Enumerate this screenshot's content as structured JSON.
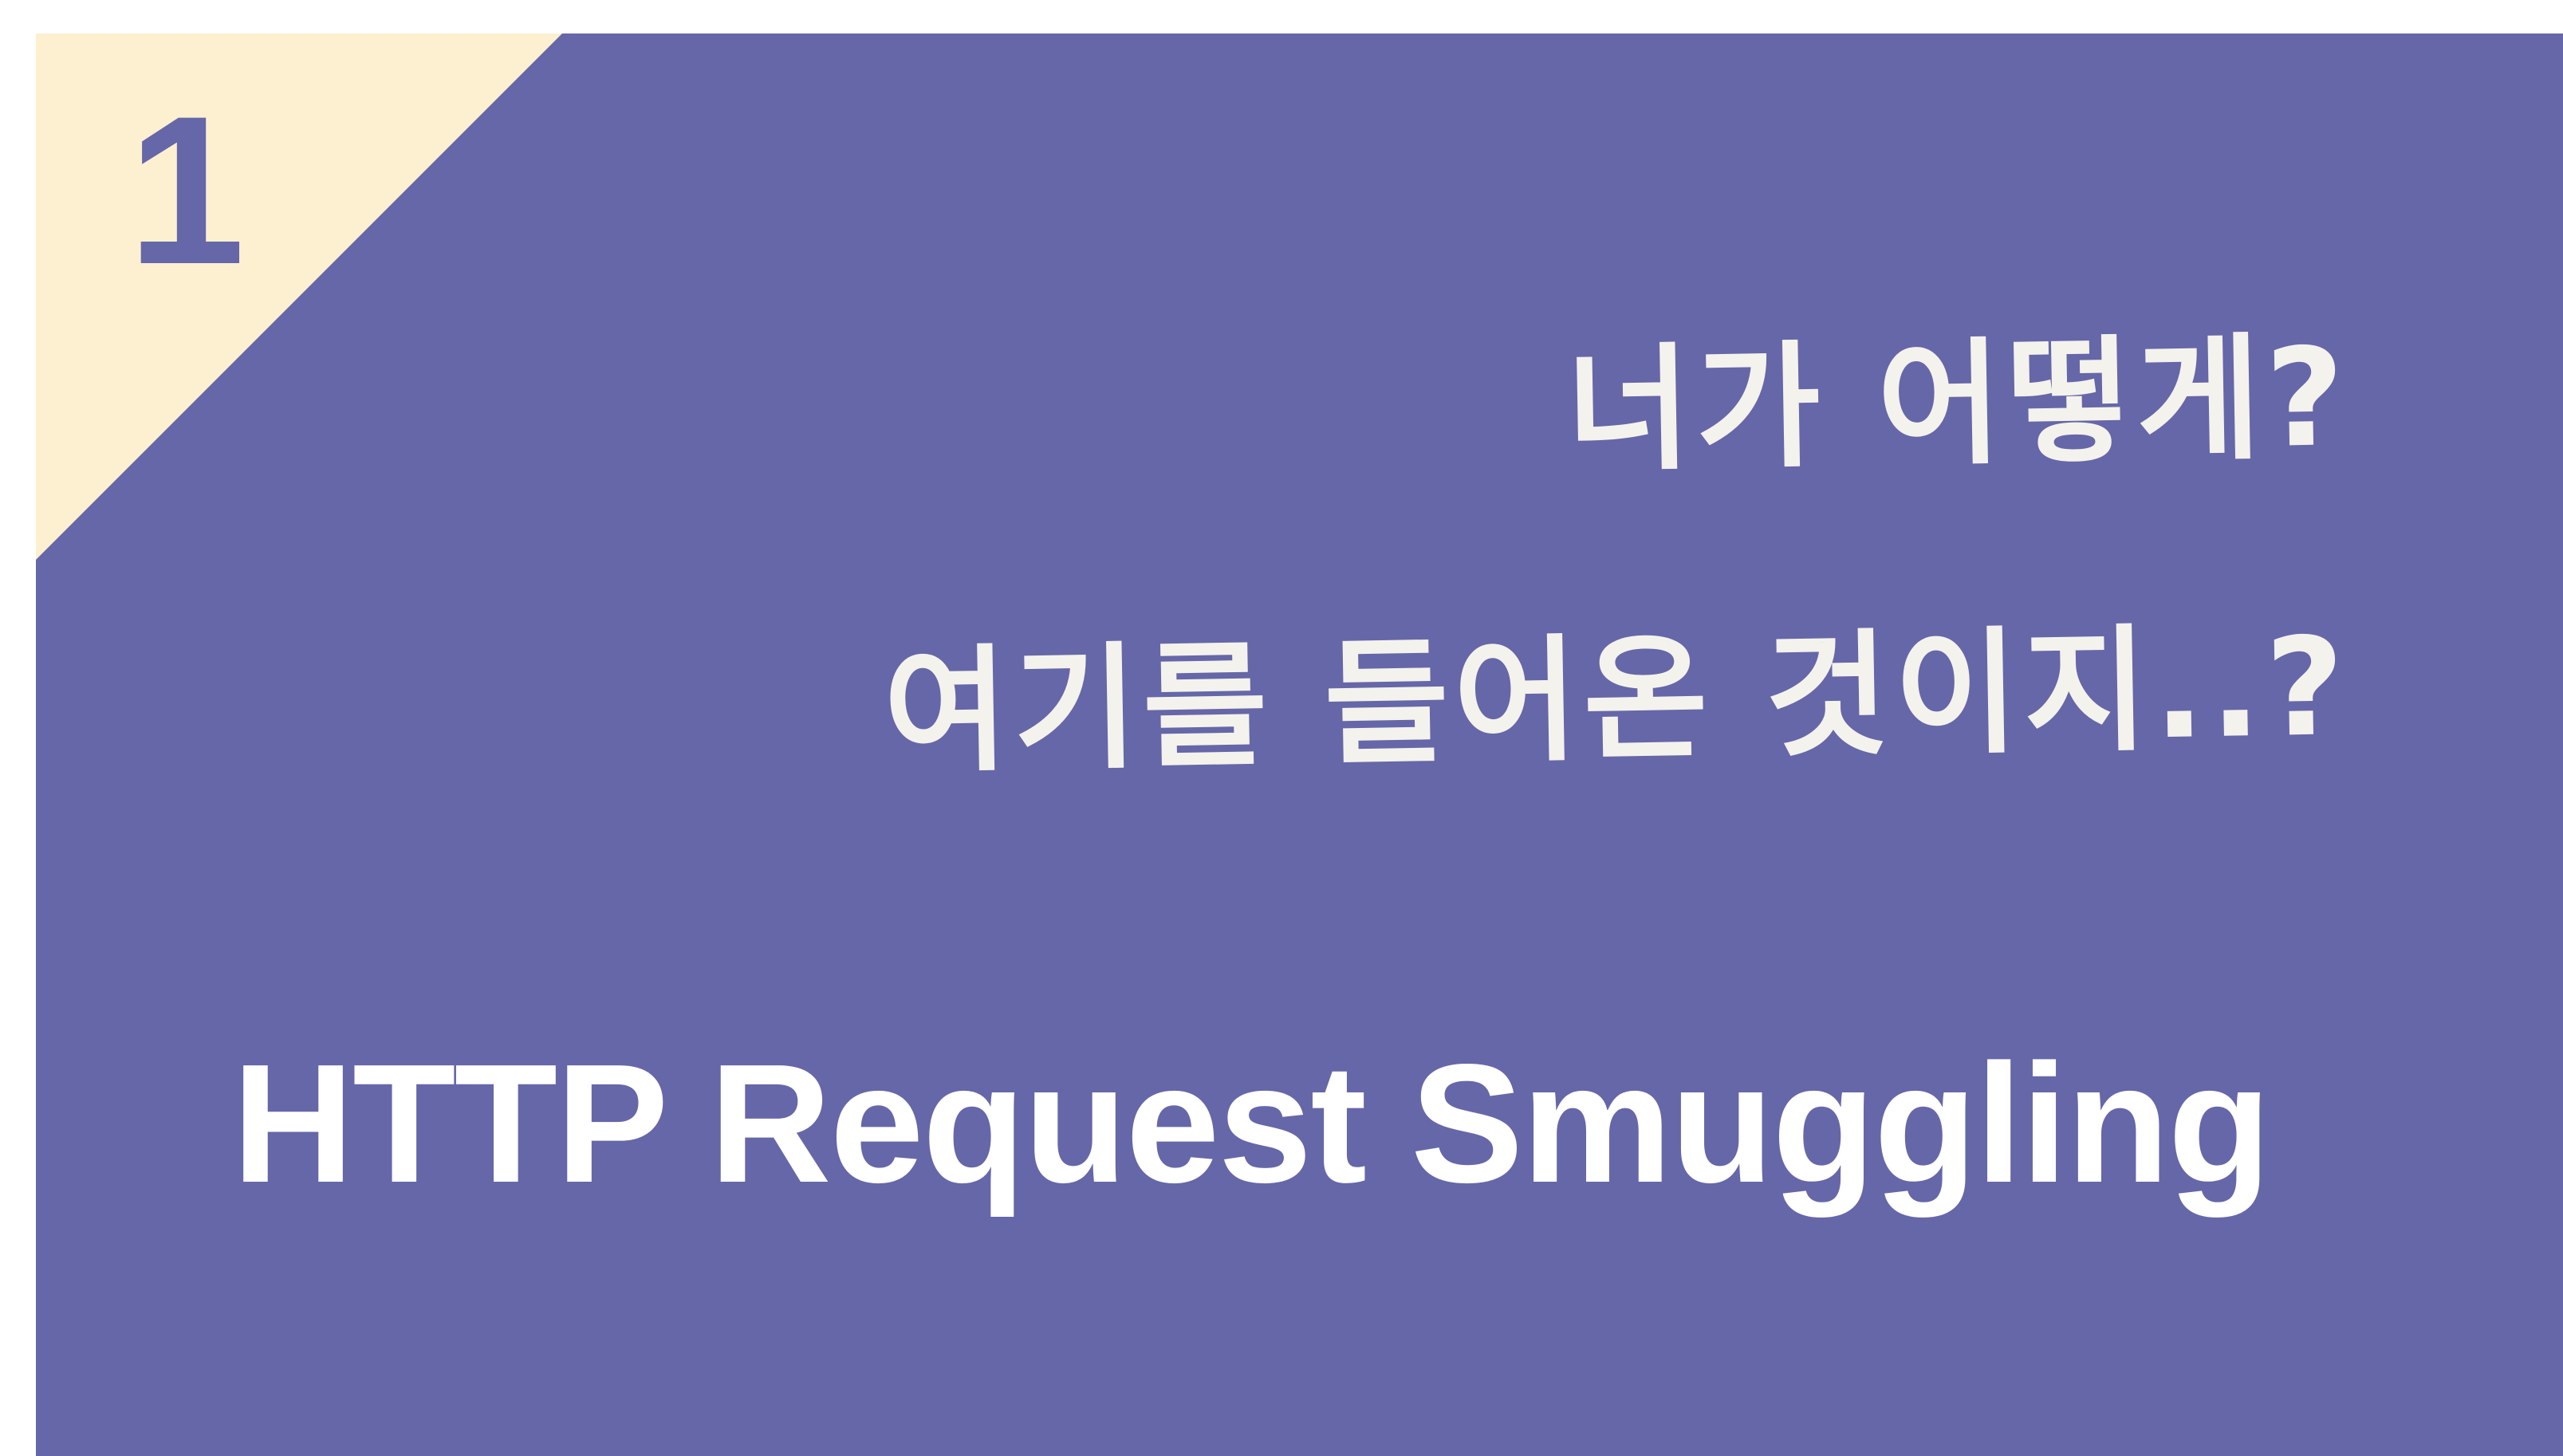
{
  "slide": {
    "number": "1",
    "subtitle_line1": "너가 어떻게?",
    "subtitle_line2": "여기를 들어온 것이지..?",
    "title": "HTTP Request Smuggling"
  },
  "colors": {
    "background": "#6667a8",
    "corner_triangle": "#fdf0d0",
    "text": "#ffffff"
  }
}
